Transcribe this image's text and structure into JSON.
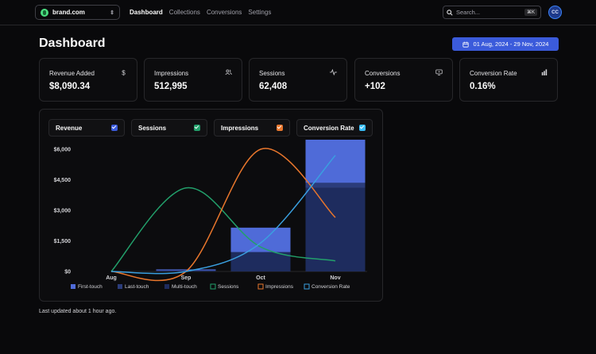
{
  "header": {
    "brand": "brand.com",
    "nav": [
      "Dashboard",
      "Collections",
      "Conversions",
      "Settings"
    ],
    "search_placeholder": "Search...",
    "search_shortcut": "⌘K",
    "avatar_initials": "CC"
  },
  "page": {
    "title": "Dashboard",
    "date_range": "01 Aug, 2024 - 29 Nov, 2024"
  },
  "stats": [
    {
      "label": "Revenue Added",
      "value": "$8,090.34",
      "icon": "dollar-icon"
    },
    {
      "label": "Impressions",
      "value": "512,995",
      "icon": "users-icon"
    },
    {
      "label": "Sessions",
      "value": "62,408",
      "icon": "activity-icon"
    },
    {
      "label": "Conversions",
      "value": "+102",
      "icon": "monitor-icon"
    },
    {
      "label": "Conversion Rate",
      "value": "0.16%",
      "icon": "bar-chart-icon"
    }
  ],
  "toggles": [
    {
      "label": "Revenue",
      "color": "#3b5bdb",
      "checked": true
    },
    {
      "label": "Sessions",
      "color": "#22a06b",
      "checked": true
    },
    {
      "label": "Impressions",
      "color": "#e8762c",
      "checked": true
    },
    {
      "label": "Conversion Rate",
      "color": "#38bdf8",
      "checked": true
    }
  ],
  "chart_data": {
    "type": "bar",
    "categories": [
      "Aug",
      "Sep",
      "Oct",
      "Nov"
    ],
    "y_ticks": [
      "$0",
      "$1,500",
      "$3,000",
      "$4,500",
      "$6,000"
    ],
    "ylim": [
      0,
      6000
    ],
    "grid": false,
    "legend_placement": "bottom",
    "series": [
      {
        "name": "First-touch",
        "kind": "bar",
        "color": "#4f6bd8",
        "values": [
          0,
          50,
          1200,
          2200
        ]
      },
      {
        "name": "Last-touch",
        "kind": "bar",
        "color": "#2b3c7a",
        "values": [
          0,
          0,
          0,
          250
        ]
      },
      {
        "name": "Multi-touch",
        "kind": "bar",
        "color": "#1e2c5e",
        "values": [
          0,
          50,
          950,
          4100
        ]
      },
      {
        "name": "Sessions",
        "kind": "line",
        "color": "#22a06b",
        "values": [
          0,
          4100,
          1200,
          520
        ]
      },
      {
        "name": "Impressions",
        "kind": "line",
        "color": "#e8762c",
        "values": [
          0,
          0,
          6000,
          2650
        ]
      },
      {
        "name": "Conversion Rate",
        "kind": "line",
        "color": "#3aa0e0",
        "values": [
          0,
          0,
          1400,
          5700
        ]
      }
    ]
  },
  "footer": {
    "last_updated": "Last updated about 1 hour ago."
  }
}
